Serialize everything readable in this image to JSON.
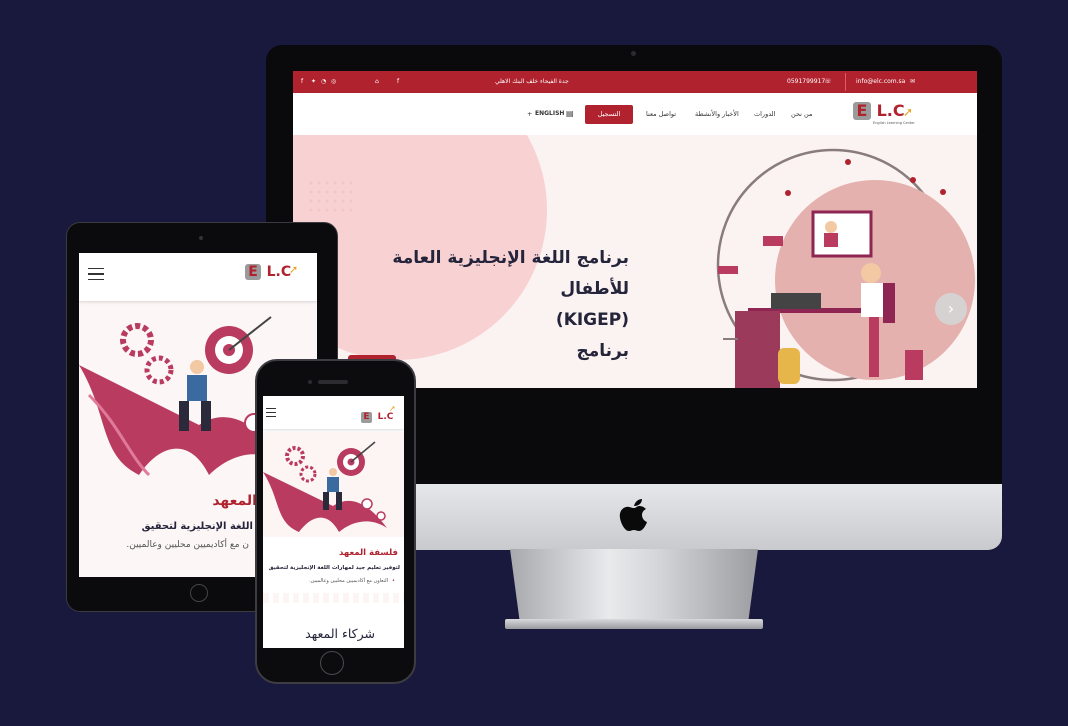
{
  "desktop": {
    "topbar": {
      "email": "info@elc.com.sa",
      "phone": "0591799917",
      "address": "جدة الفيحاء خلف البنك الاهلي"
    },
    "nav": {
      "logo_text": "L.C",
      "logo_letter": "E",
      "logo_tagline": "English Learning Center",
      "items": [
        "من نحن",
        "الدورات",
        "الأخبار والأنشطة",
        "تواصل معنا"
      ],
      "signup_label": "التسجيل",
      "language_label": "ENGLISH",
      "language_toggle": "+"
    },
    "hero": {
      "title_line1": "برنامج اللغة الإنجليزية العامة للأطفال",
      "title_line2": "(KIGEP)",
      "title_line3": "برنامج",
      "next_icon": "›"
    }
  },
  "tablet": {
    "logo_text": "L.C",
    "logo_letter": "E",
    "heading": "المعهد",
    "line1": "جيد لمهارات اللغة الإنجليزية لتحقيق",
    "line2": "ن مع أكاديميين محليين وعالميين."
  },
  "phone": {
    "logo_text": "L.C",
    "logo_letter": "E",
    "heading": "فلسفة المعهد",
    "line1": "لتوفير تعليم جيد لمهارات اللغة الإنجليزية لتحقيق",
    "bullet": "التعاون مع أكاديميين محليين وعالميين.",
    "partners": "شركاء المعهد"
  },
  "colors": {
    "brand": "#b0222e",
    "background": "#19183d",
    "hero_bg": "#fbf3f2",
    "illustration": "#b93b5f"
  }
}
